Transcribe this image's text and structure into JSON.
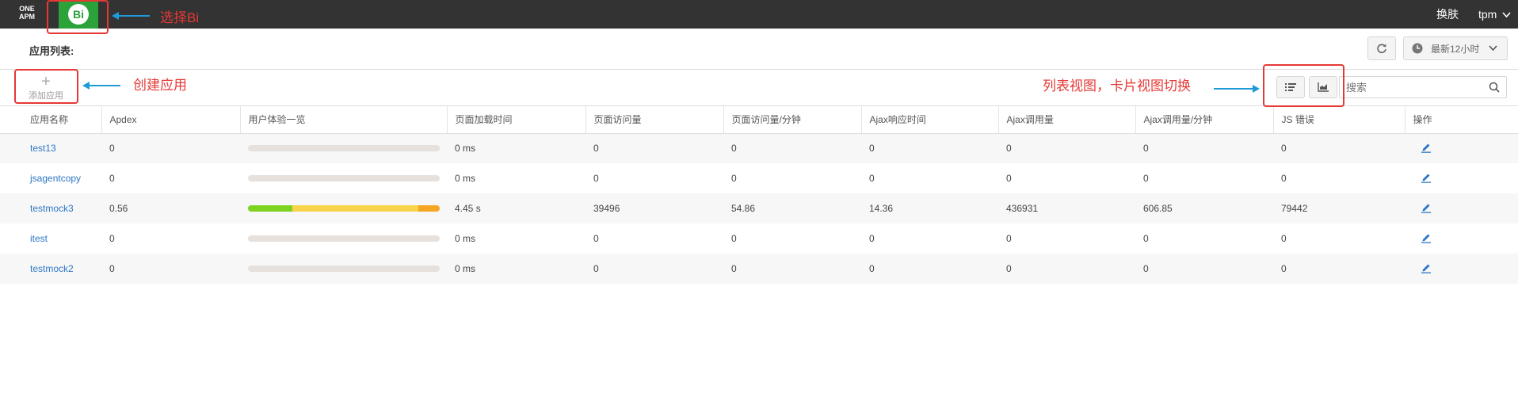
{
  "topbar": {
    "logo_line1": "ONE",
    "logo_line2": "APM",
    "bi_label": "Bi",
    "skin_label": "换肤",
    "user_label": "tpm"
  },
  "annotations": {
    "select_bi": "选择Bi",
    "create_app": "创建应用",
    "switch_view": "列表视图，卡片视图切换"
  },
  "header": {
    "title": "应用列表:",
    "time_range": "最新12小时"
  },
  "toolbar": {
    "add_label": "添加应用",
    "search_placeholder": "搜索"
  },
  "table": {
    "columns": [
      "应用名称",
      "Apdex",
      "用户体验一览",
      "页面加载时间",
      "页面访问量",
      "页面访问量/分钟",
      "Ajax响应时间",
      "Ajax调用量",
      "Ajax调用量/分钟",
      "JS 错误",
      "操作"
    ],
    "rows": [
      {
        "name": "test13",
        "apdex": "0",
        "experience": [],
        "load": "0 ms",
        "pv": "0",
        "pvm": "0",
        "ajax_rt": "0",
        "ajax_calls": "0",
        "ajax_cpm": "0",
        "js_err": "0"
      },
      {
        "name": "jsagentcopy",
        "apdex": "0",
        "experience": [],
        "load": "0 ms",
        "pv": "0",
        "pvm": "0",
        "ajax_rt": "0",
        "ajax_calls": "0",
        "ajax_cpm": "0",
        "js_err": "0"
      },
      {
        "name": "testmock3",
        "apdex": "0.56",
        "experience": [
          {
            "share": 0.23,
            "color": "#7ed321"
          },
          {
            "share": 0.66,
            "color": "#f8d44a"
          },
          {
            "share": 0.11,
            "color": "#f5a623"
          }
        ],
        "load": "4.45 s",
        "pv": "39496",
        "pvm": "54.86",
        "ajax_rt": "14.36",
        "ajax_calls": "436931",
        "ajax_cpm": "606.85",
        "js_err": "79442"
      },
      {
        "name": "itest",
        "apdex": "0",
        "experience": [],
        "load": "0 ms",
        "pv": "0",
        "pvm": "0",
        "ajax_rt": "0",
        "ajax_calls": "0",
        "ajax_cpm": "0",
        "js_err": "0"
      },
      {
        "name": "testmock2",
        "apdex": "0",
        "experience": [],
        "load": "0 ms",
        "pv": "0",
        "pvm": "0",
        "ajax_rt": "0",
        "ajax_calls": "0",
        "ajax_cpm": "0",
        "js_err": "0"
      }
    ]
  },
  "icons": [
    "refresh-icon",
    "clock-icon",
    "chevron-down-icon",
    "list-view-icon",
    "card-view-icon",
    "search-icon",
    "edit-icon"
  ],
  "colors": {
    "topbar": "#333333",
    "bi_green": "#2ba23a",
    "annotation_red": "#e53935",
    "arrow_blue": "#1e9bd7",
    "link_blue": "#2d77c7"
  }
}
